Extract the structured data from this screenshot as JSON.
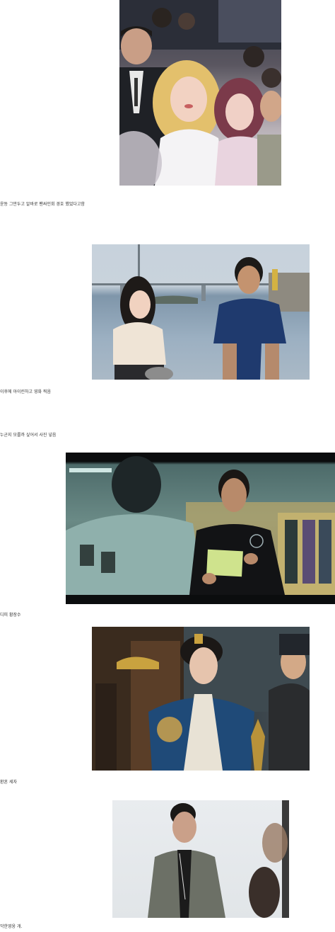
{
  "captions": {
    "c1": "윤동 그만두고 알바로 팬싸인회 경호 했었다고함",
    "c2": "이후에 아이린하고 영화 찍음",
    "c3": "누군지 모를까 싶어서 사진 넣음",
    "c4": "디피 황장수",
    "c5": "환혼 세자",
    "c6": "악한영웅 개."
  },
  "photos": {
    "p1": "fan-sign-event-photo",
    "p2": "seaside-movie-still",
    "p3": "locker-room-drama-still",
    "p4": "royal-prince-drama-still",
    "p5": "hero-drama-still"
  }
}
